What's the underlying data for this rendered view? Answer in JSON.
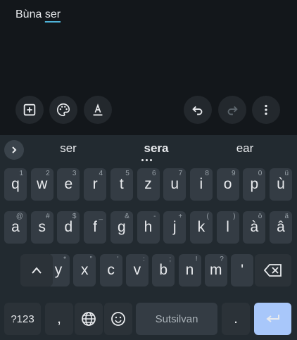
{
  "note": {
    "prefix": "Bùna ",
    "typing": "ser"
  },
  "toolbar": {
    "add": "add-box-icon",
    "palette": "palette-icon",
    "format": "text-format-icon",
    "undo": "undo-icon",
    "redo": "redo-icon",
    "more": "more-vert-icon"
  },
  "suggestions": [
    "ser",
    "sera",
    "ear"
  ],
  "rows": {
    "row1": [
      {
        "k": "q",
        "h": "1"
      },
      {
        "k": "w",
        "h": "2"
      },
      {
        "k": "e",
        "h": "3"
      },
      {
        "k": "r",
        "h": "4"
      },
      {
        "k": "t",
        "h": "5"
      },
      {
        "k": "z",
        "h": "6"
      },
      {
        "k": "u",
        "h": "7"
      },
      {
        "k": "i",
        "h": "8"
      },
      {
        "k": "o",
        "h": "9"
      },
      {
        "k": "p",
        "h": "0"
      },
      {
        "k": "ù",
        "h": "ü"
      }
    ],
    "row2": [
      {
        "k": "a",
        "h": "@"
      },
      {
        "k": "s",
        "h": "#"
      },
      {
        "k": "d",
        "h": "$"
      },
      {
        "k": "f",
        "h": "_"
      },
      {
        "k": "g",
        "h": "&"
      },
      {
        "k": "h",
        "h": "-"
      },
      {
        "k": "j",
        "h": "+"
      },
      {
        "k": "k",
        "h": "("
      },
      {
        "k": "l",
        "h": ")"
      },
      {
        "k": "à",
        "h": "ö"
      },
      {
        "k": "â",
        "h": "ä"
      }
    ],
    "row3": [
      {
        "k": "y",
        "h": "*"
      },
      {
        "k": "x",
        "h": "\""
      },
      {
        "k": "c",
        "h": "'"
      },
      {
        "k": "v",
        "h": ":"
      },
      {
        "k": "b",
        "h": ";"
      },
      {
        "k": "n",
        "h": "!"
      },
      {
        "k": "m",
        "h": "?"
      },
      {
        "k": "'",
        "h": ""
      }
    ]
  },
  "bottom": {
    "symbols": "?123",
    "comma": ",",
    "space": "Sutsilvan",
    "period": "."
  }
}
